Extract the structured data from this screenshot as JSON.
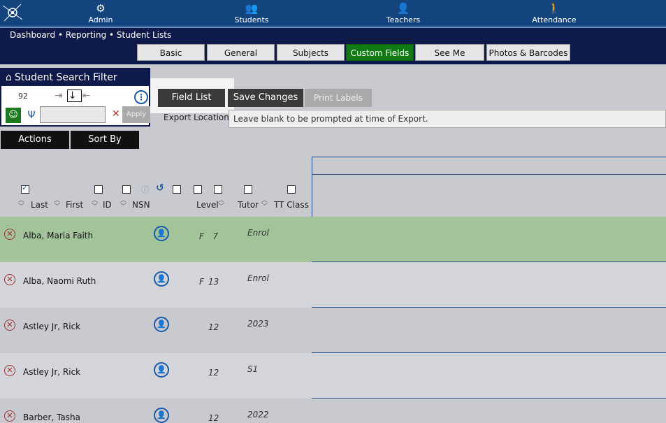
{
  "nav": {
    "items": [
      {
        "label": "Admin",
        "icon": "admin-icon"
      },
      {
        "label": "Students",
        "icon": "students-icon"
      },
      {
        "label": "Teachers",
        "icon": "teachers-icon"
      },
      {
        "label": "Attendance",
        "icon": "attendance-icon"
      }
    ]
  },
  "breadcrumb": [
    "Dashboard",
    "Reporting",
    "Student Lists"
  ],
  "tabs": [
    {
      "label": "Basic",
      "active": false
    },
    {
      "label": "General",
      "active": false
    },
    {
      "label": "Subjects",
      "active": false
    },
    {
      "label": "Custom Fields",
      "active": true
    },
    {
      "label": "See Me",
      "active": false
    },
    {
      "label": "Photos & Barcodes",
      "active": false
    }
  ],
  "filter": {
    "title": "Student Search Filter",
    "count": "92",
    "apply_label": "Apply",
    "input_value": ""
  },
  "buttons": {
    "field_list": "Field List",
    "save_changes": "Save Changes",
    "print_labels": "Print Labels",
    "actions": "Actions",
    "sort_by": "Sort By"
  },
  "export": {
    "label": "Export Location",
    "value": "Leave blank to be prompted at time of Export."
  },
  "columns": {
    "last": "Last",
    "first": "First",
    "id": "ID",
    "nsn": "NSN",
    "level": "Level",
    "tutor": "Tutor",
    "tt_class": "TT Class"
  },
  "rows": [
    {
      "name": "Alba, Maria Faith",
      "gender": "F",
      "level": "7",
      "tutor": "Enrol",
      "highlight": true
    },
    {
      "name": "Alba, Naomi Ruth",
      "gender": "F",
      "level": "13",
      "tutor": "Enrol",
      "highlight": false
    },
    {
      "name": "Astley Jr, Rick",
      "gender": "",
      "level": "12",
      "tutor": "2023",
      "highlight": false
    },
    {
      "name": "Astley Jr, Rick",
      "gender": "",
      "level": "12",
      "tutor": "S1",
      "highlight": false
    },
    {
      "name": "Barber, Tasha",
      "gender": "",
      "level": "12",
      "tutor": "2022",
      "highlight": false
    }
  ],
  "colors": {
    "nav": "#14447e",
    "subbar": "#0e1a4a",
    "active_tab": "#117a14",
    "row_highlight": "#a3c49b",
    "row_alt": "#c9cacf",
    "row_plain": "#d4d5da"
  }
}
